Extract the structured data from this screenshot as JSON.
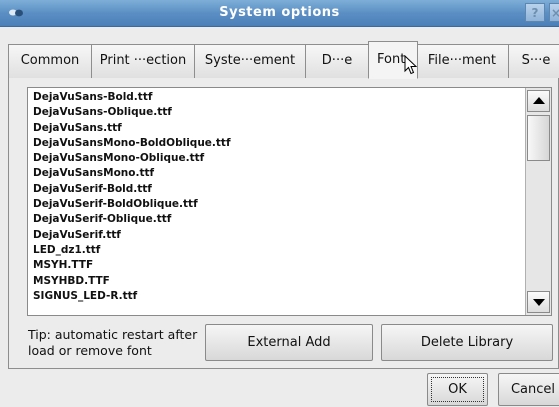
{
  "window": {
    "title": "System options",
    "icon": "app-icon",
    "help_label": "?",
    "close_label": "×"
  },
  "tabs": [
    {
      "label": "Common"
    },
    {
      "label": "Print ···ection"
    },
    {
      "label": "Syste···ement"
    },
    {
      "label": "D···e"
    },
    {
      "label": "Font"
    },
    {
      "label": "File···ment"
    },
    {
      "label": "S···e"
    }
  ],
  "active_tab": "Font",
  "font_list": {
    "items": [
      "DejaVuSans-Bold.ttf",
      "DejaVuSans-Oblique.ttf",
      "DejaVuSans.ttf",
      "DejaVuSansMono-BoldOblique.ttf",
      "DejaVuSansMono-Oblique.ttf",
      "DejaVuSansMono.ttf",
      "DejaVuSerif-Bold.ttf",
      "DejaVuSerif-BoldOblique.ttf",
      "DejaVuSerif-Oblique.ttf",
      "DejaVuSerif.ttf",
      "LED_dz1.ttf",
      "MSYH.TTF",
      "MSYHBD.TTF",
      "SIGNUS_LED-R.ttf"
    ]
  },
  "tip": "Tip: automatic restart after load or remove font",
  "buttons": {
    "external_add": "External Add",
    "delete_library": "Delete Library",
    "ok": "OK",
    "cancel": "Cancel"
  },
  "colors": {
    "titlebar": "#5b8fc4",
    "background": "#ececec"
  }
}
